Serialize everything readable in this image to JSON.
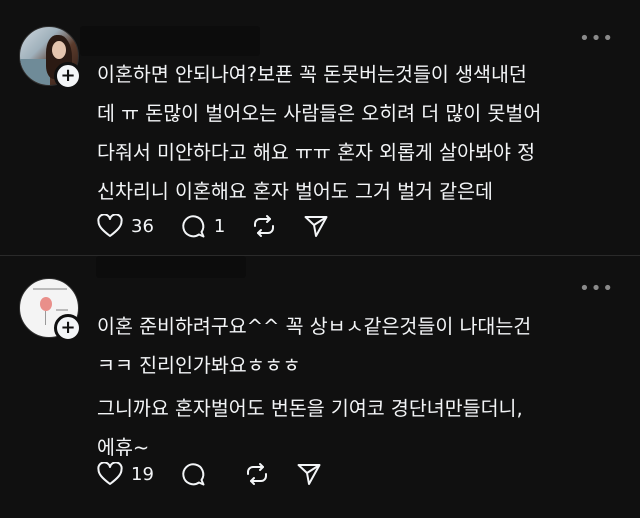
{
  "posts": [
    {
      "text_lines": [
        "이혼하면 안되나여?보푠 꼭 돈못버는것들이 생색내던",
        "데 ㅠ 돈많이 벌어오는 사람들은 오히려 더 많이 못벌어",
        "다줘서 미안하다고 해요 ㅠㅠ 혼자 외롭게 살아봐야 정",
        "신차리니 이혼해요 혼자 벌어도 그거 벌거 같은데"
      ],
      "more_label": "•••",
      "like_count": "36",
      "reply_count": "1"
    },
    {
      "text_lines": [
        "이혼 준비하려구요^^ 꼭 상ㅂㅅ같은것들이 나대는건",
        "ㅋㅋ 진리인가봐요ㅎㅎㅎ",
        "그니까요 혼자벌어도 번돈을 기여코 경단녀만들더니,",
        "에휴~"
      ],
      "more_label": "•••",
      "like_count": "19",
      "reply_count": ""
    }
  ],
  "icons": {
    "like": "heart-icon",
    "reply": "comment-icon",
    "repost": "repost-icon",
    "share": "send-icon",
    "follow": "plus-icon"
  },
  "badge_label": "+"
}
